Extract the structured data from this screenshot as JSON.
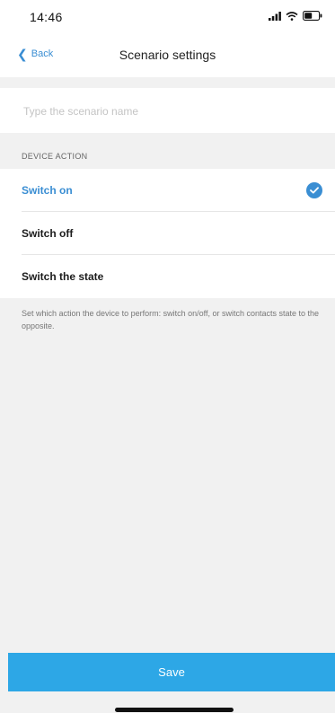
{
  "status_bar": {
    "time": "14:46"
  },
  "nav": {
    "back_label": "Back",
    "title": "Scenario settings"
  },
  "name_input": {
    "placeholder": "Type the scenario name",
    "value": ""
  },
  "section": {
    "header": "DEVICE ACTION"
  },
  "actions": {
    "items": [
      {
        "label": "Switch on",
        "selected": true
      },
      {
        "label": "Switch off",
        "selected": false
      },
      {
        "label": "Switch the state",
        "selected": false
      }
    ]
  },
  "description": "Set which action the device to perform: switch on/off, or switch contacts state to the opposite.",
  "footer": {
    "save_label": "Save"
  },
  "colors": {
    "accent": "#3a8ed3",
    "save_bar": "#2da7e6",
    "background": "#f1f1f1"
  }
}
